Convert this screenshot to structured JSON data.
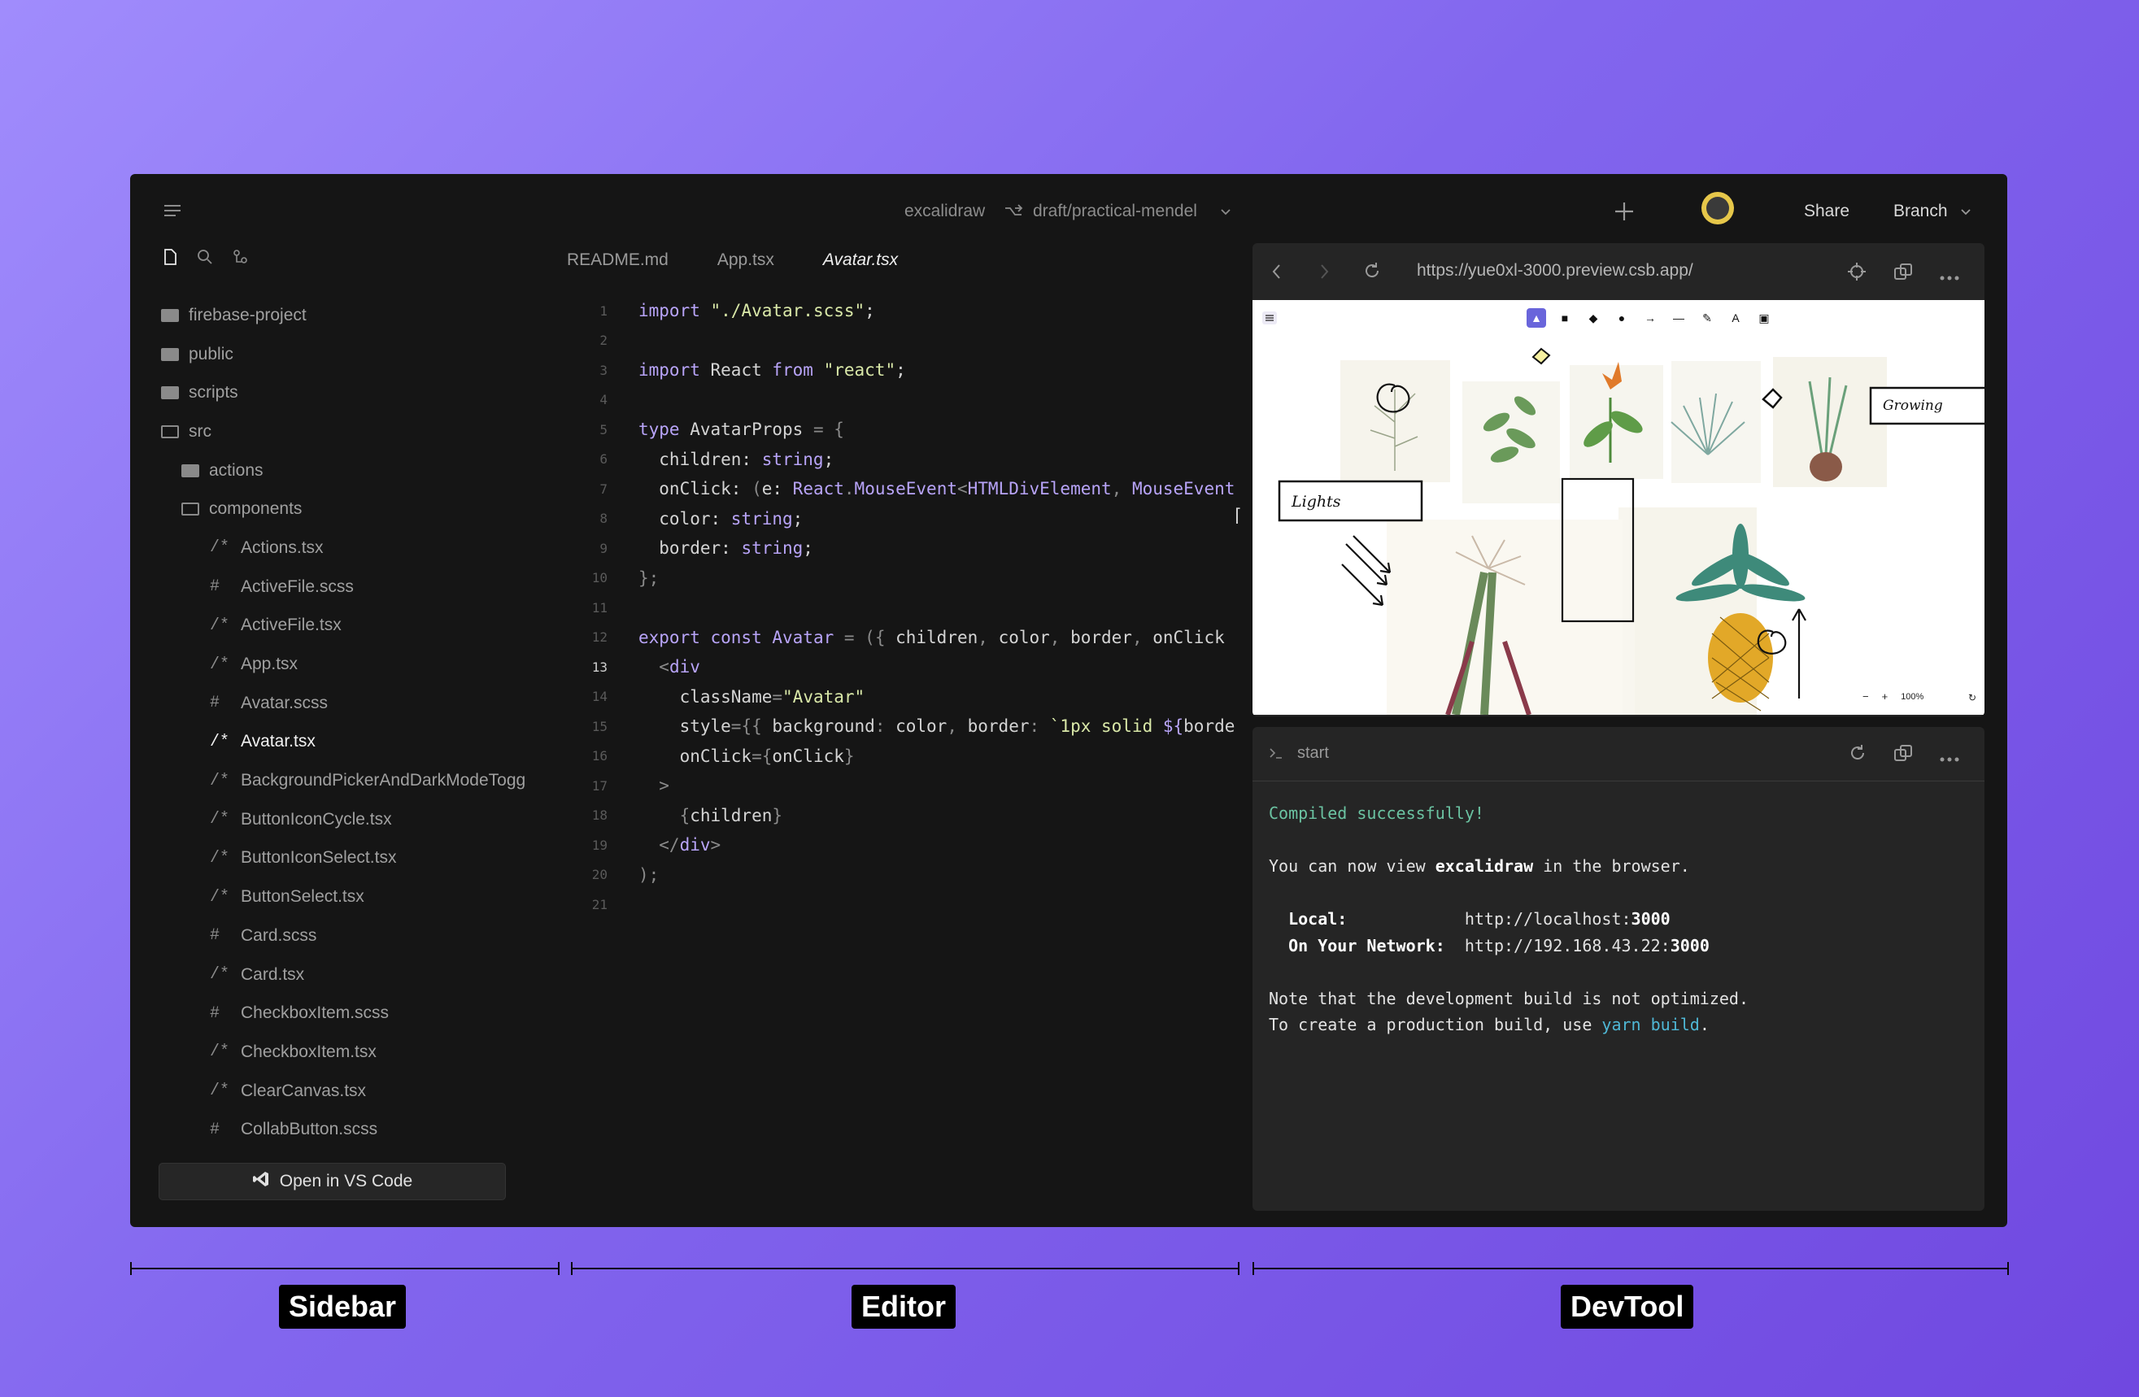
{
  "header": {
    "project": "excalidraw",
    "branch": "draft/practical-mendel",
    "share_label": "Share",
    "branch_menu_label": "Branch"
  },
  "sidebar": {
    "items": [
      {
        "label": "firebase-project",
        "type": "folder",
        "indent": 0
      },
      {
        "label": "public",
        "type": "folder",
        "indent": 0
      },
      {
        "label": "scripts",
        "type": "folder",
        "indent": 0
      },
      {
        "label": "src",
        "type": "folder-open",
        "indent": 0
      },
      {
        "label": "actions",
        "type": "folder",
        "indent": 1
      },
      {
        "label": "components",
        "type": "folder-open",
        "indent": 1
      },
      {
        "label": "Actions.tsx",
        "type": "tsx",
        "indent": 2
      },
      {
        "label": "ActiveFile.scss",
        "type": "scss",
        "indent": 2
      },
      {
        "label": "ActiveFile.tsx",
        "type": "tsx",
        "indent": 2
      },
      {
        "label": "App.tsx",
        "type": "tsx",
        "indent": 2
      },
      {
        "label": "Avatar.scss",
        "type": "scss",
        "indent": 2
      },
      {
        "label": "Avatar.tsx",
        "type": "tsx",
        "indent": 2,
        "active": true
      },
      {
        "label": "BackgroundPickerAndDarkModeTogg",
        "type": "tsx",
        "indent": 2
      },
      {
        "label": "ButtonIconCycle.tsx",
        "type": "tsx",
        "indent": 2
      },
      {
        "label": "ButtonIconSelect.tsx",
        "type": "tsx",
        "indent": 2
      },
      {
        "label": "ButtonSelect.tsx",
        "type": "tsx",
        "indent": 2
      },
      {
        "label": "Card.scss",
        "type": "scss",
        "indent": 2
      },
      {
        "label": "Card.tsx",
        "type": "tsx",
        "indent": 2
      },
      {
        "label": "CheckboxItem.scss",
        "type": "scss",
        "indent": 2
      },
      {
        "label": "CheckboxItem.tsx",
        "type": "tsx",
        "indent": 2
      },
      {
        "label": "ClearCanvas.tsx",
        "type": "tsx",
        "indent": 2
      },
      {
        "label": "CollabButton.scss",
        "type": "scss",
        "indent": 2
      }
    ],
    "tsx_icon": "/*",
    "scss_icon": "#",
    "open_vscode_label": "Open in VS Code"
  },
  "editor": {
    "tabs": [
      "README.md",
      "App.tsx",
      "Avatar.tsx"
    ],
    "active_tab": 2,
    "current_line": 13,
    "lines": [
      [
        [
          "kw",
          "import "
        ],
        [
          "str",
          "\"./Avatar.scss\""
        ],
        [
          "ct",
          ";"
        ]
      ],
      [],
      [
        [
          "kw",
          "import "
        ],
        [
          "ct",
          "React "
        ],
        [
          "kw",
          "from "
        ],
        [
          "str",
          "\"react\""
        ],
        [
          "ct",
          ";"
        ]
      ],
      [],
      [
        [
          "kw",
          "type "
        ],
        [
          "ct",
          "AvatarProps "
        ],
        [
          "pn",
          "= {"
        ]
      ],
      [
        [
          "ct",
          "  children: "
        ],
        [
          "ty",
          "string"
        ],
        [
          "ct",
          ";"
        ]
      ],
      [
        [
          "ct",
          "  onClick: "
        ],
        [
          "pn",
          "("
        ],
        [
          "ct",
          "e: "
        ],
        [
          "ty",
          "React"
        ],
        [
          "pn",
          "."
        ],
        [
          "ty",
          "MouseEvent"
        ],
        [
          "pn",
          "<"
        ],
        [
          "ty",
          "HTMLDivElement"
        ],
        [
          "pn",
          ", "
        ],
        [
          "ty",
          "MouseEvent"
        ]
      ],
      [
        [
          "ct",
          "  color: "
        ],
        [
          "ty",
          "string"
        ],
        [
          "ct",
          ";"
        ]
      ],
      [
        [
          "ct",
          "  border: "
        ],
        [
          "ty",
          "string"
        ],
        [
          "ct",
          ";"
        ]
      ],
      [
        [
          "pn",
          "};"
        ]
      ],
      [],
      [
        [
          "kw",
          "export const "
        ],
        [
          "ty",
          "Avatar "
        ],
        [
          "pn",
          "= ({ "
        ],
        [
          "ct",
          "children"
        ],
        [
          "pn",
          ", "
        ],
        [
          "ct",
          "color"
        ],
        [
          "pn",
          ", "
        ],
        [
          "ct",
          "border"
        ],
        [
          "pn",
          ", "
        ],
        [
          "ct",
          "onClick"
        ]
      ],
      [
        [
          "pn",
          "  <"
        ],
        [
          "kw",
          "div"
        ]
      ],
      [
        [
          "ct",
          "    className"
        ],
        [
          "pn",
          "="
        ],
        [
          "str",
          "\"Avatar\""
        ]
      ],
      [
        [
          "ct",
          "    style"
        ],
        [
          "pn",
          "={{ "
        ],
        [
          "ct",
          "background"
        ],
        [
          "pn",
          ": "
        ],
        [
          "ct",
          "color"
        ],
        [
          "pn",
          ", "
        ],
        [
          "ct",
          "border"
        ],
        [
          "pn",
          ": "
        ],
        [
          "str",
          "`1px solid "
        ],
        [
          "kw",
          "${"
        ],
        [
          "ct",
          "borde"
        ]
      ],
      [
        [
          "ct",
          "    onClick"
        ],
        [
          "pn",
          "={"
        ],
        [
          "ct",
          "onClick"
        ],
        [
          "pn",
          "}"
        ]
      ],
      [
        [
          "pn",
          "  >"
        ]
      ],
      [
        [
          "pn",
          "    {"
        ],
        [
          "ct",
          "children"
        ],
        [
          "pn",
          "}"
        ]
      ],
      [
        [
          "pn",
          "  </"
        ],
        [
          "kw",
          "div"
        ],
        [
          "pn",
          ">"
        ]
      ],
      [
        [
          "pn",
          ");"
        ]
      ],
      []
    ]
  },
  "devtool": {
    "url": "https://yue0xl-3000.preview.csb.app/",
    "canvas": {
      "label_lights": "Lights",
      "label_growing": "Growing",
      "zoom": "100%",
      "zoom_minus": "−",
      "zoom_plus": "+"
    },
    "terminal": {
      "title": "start",
      "compiled": "Compiled successfully!",
      "view_prefix": "You can now view ",
      "app_name": "excalidraw",
      "view_suffix": " in the browser.",
      "local_label": "  Local:",
      "local_url_prefix": "http://localhost:",
      "local_port": "3000",
      "network_label": "  On Your Network:",
      "network_url_prefix": "http://192.168.43.22:",
      "network_port": "3000",
      "note": "Note that the development build is not optimized.",
      "prod_prefix": "To create a production build, use ",
      "prod_cmd": "yarn build",
      "prod_suffix": "."
    }
  },
  "sections": {
    "sidebar": "Sidebar",
    "editor": "Editor",
    "devtool": "DevTool"
  },
  "colors": {
    "accent": "#6965db",
    "terminal_green": "#6bc3a2",
    "terminal_blue": "#4fb7d5"
  }
}
